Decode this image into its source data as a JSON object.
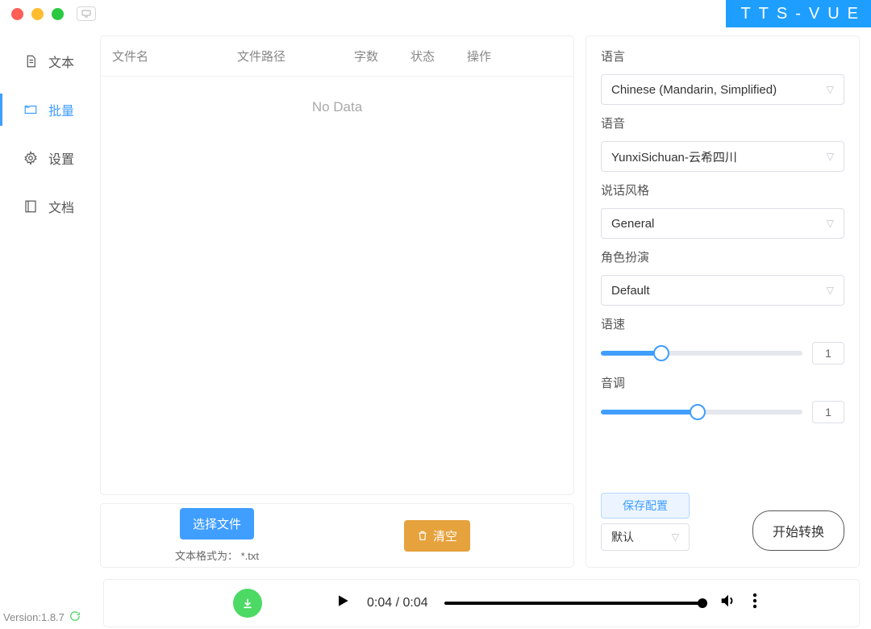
{
  "window": {
    "app_title": "TTS-VUE"
  },
  "sidebar": {
    "items": [
      {
        "label": "文本"
      },
      {
        "label": "批量"
      },
      {
        "label": "设置"
      },
      {
        "label": "文档"
      }
    ],
    "version_label": "Version:1.8.7"
  },
  "table": {
    "headers": {
      "name": "文件名",
      "path": "文件路径",
      "words": "字数",
      "status": "状态",
      "actions": "操作"
    },
    "empty_text": "No Data"
  },
  "file_toolbar": {
    "choose_btn": "选择文件",
    "format_hint": "文本格式为：  *.txt",
    "clear_btn": "清空"
  },
  "config": {
    "language_label": "语言",
    "language_value": "Chinese (Mandarin, Simplified)",
    "voice_label": "语音",
    "voice_value": "YunxiSichuan-云希四川",
    "style_label": "说话风格",
    "style_value": "General",
    "role_label": "角色扮演",
    "role_value": "Default",
    "speed_label": "语速",
    "speed_value": "1",
    "speed_percent": 30,
    "pitch_label": "音调",
    "pitch_value": "1",
    "pitch_percent": 48,
    "save_btn": "保存配置",
    "preset_value": "默认",
    "start_btn": "开始转换"
  },
  "player": {
    "time": "0:04 / 0:04"
  }
}
